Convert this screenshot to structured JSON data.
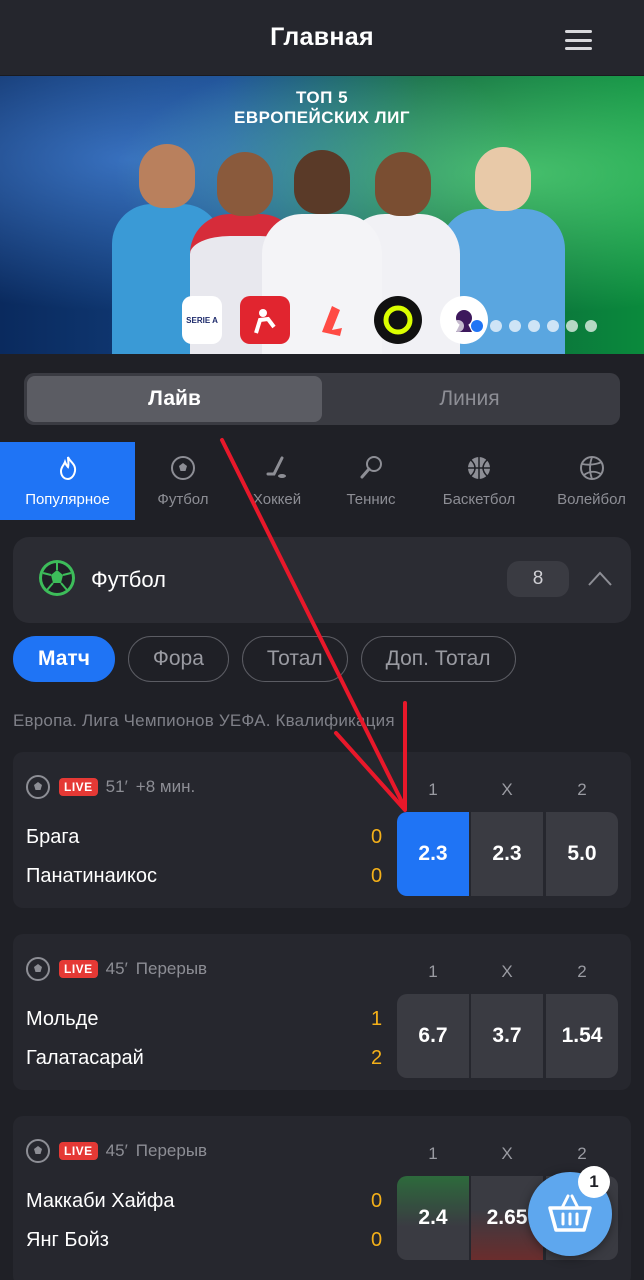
{
  "header": {
    "title": "Главная"
  },
  "banner": {
    "line1": "ТОП 5",
    "line2": "ЕВРОПЕЙСКИХ ЛИГ",
    "logos": [
      "SERIE A",
      "",
      "",
      "",
      ""
    ]
  },
  "segment": {
    "live": "Лайв",
    "line": "Линия"
  },
  "sports": [
    {
      "label": "Популярное",
      "icon": "fire-icon"
    },
    {
      "label": "Футбол",
      "icon": "soccer-ball-icon"
    },
    {
      "label": "Хоккей",
      "icon": "hockey-stick-icon"
    },
    {
      "label": "Теннис",
      "icon": "tennis-racket-icon"
    },
    {
      "label": "Баскетбол",
      "icon": "basketball-icon"
    },
    {
      "label": "Волейбол",
      "icon": "volleyball-icon"
    }
  ],
  "football": {
    "label": "Футбол",
    "count": "8"
  },
  "filters": {
    "match": "Матч",
    "fora": "Фора",
    "total": "Тотал",
    "dop_total": "Доп. Тотал"
  },
  "breadcrumb": "Европа.  Лига Чемпионов УЕФА.  Квалификация",
  "odds_headers": {
    "h1": "1",
    "hx": "X",
    "h2": "2"
  },
  "matches": [
    {
      "minute": "51′",
      "status": "+8 мин.",
      "live": "LIVE",
      "team1": "Брага",
      "team2": "Панатинаикос",
      "score1": "0",
      "score2": "0",
      "odd1": "2.3",
      "oddx": "2.3",
      "odd2": "5.0"
    },
    {
      "minute": "45′",
      "status": "Перерыв",
      "live": "LIVE",
      "team1": "Мольде",
      "team2": "Галатасарай",
      "score1": "1",
      "score2": "2",
      "odd1": "6.7",
      "oddx": "3.7",
      "odd2": "1.54"
    },
    {
      "minute": "45′",
      "status": "Перерыв",
      "live": "LIVE",
      "team1": "Маккаби Хайфа",
      "team2": "Янг Бойз",
      "score1": "0",
      "score2": "0",
      "odd1": "2.4",
      "oddx": "2.65",
      "odd2": ""
    }
  ],
  "basket": {
    "count": "1"
  },
  "colors": {
    "accent": "#1f74f5",
    "live": "#e53935",
    "score": "#f4b019",
    "arrow": "#e8182a"
  }
}
